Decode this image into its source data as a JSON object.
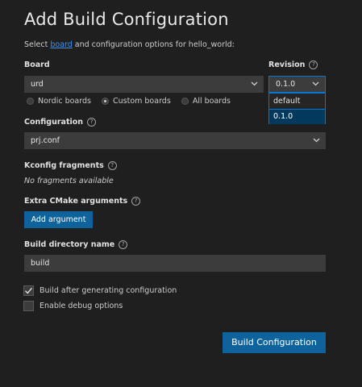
{
  "header": {
    "title": "Add Build Configuration",
    "subtitle_prefix": "Select ",
    "subtitle_link": "board",
    "subtitle_suffix": " and configuration options for hello_world:"
  },
  "board": {
    "label": "Board",
    "value": "urd",
    "radios": [
      {
        "label": "Nordic boards",
        "selected": false
      },
      {
        "label": "Custom boards",
        "selected": true
      },
      {
        "label": "All boards",
        "selected": false
      }
    ]
  },
  "revision": {
    "label": "Revision",
    "value": "0.1.0",
    "options": [
      {
        "label": "default",
        "highlighted": false
      },
      {
        "label": "0.1.0",
        "highlighted": true
      }
    ]
  },
  "configuration": {
    "label": "Configuration",
    "value": "prj.conf"
  },
  "kconfig": {
    "label": "Kconfig fragments",
    "empty_text": "No fragments available"
  },
  "cmake": {
    "label": "Extra CMake arguments",
    "button": "Add argument"
  },
  "build_dir": {
    "label": "Build directory name",
    "value": "build"
  },
  "options": {
    "build_after": {
      "label": "Build after generating configuration",
      "checked": true
    },
    "debug": {
      "label": "Enable debug options",
      "checked": false
    }
  },
  "actions": {
    "build_button": "Build Configuration"
  },
  "colors": {
    "background": "#1f1f1f",
    "input": "#3c3c3c",
    "accent": "#0e639c",
    "link": "#3794ff",
    "focus": "#0078d4"
  },
  "icons": {
    "help": "?",
    "chevron": "chevron-down-icon",
    "check": "check-icon"
  }
}
